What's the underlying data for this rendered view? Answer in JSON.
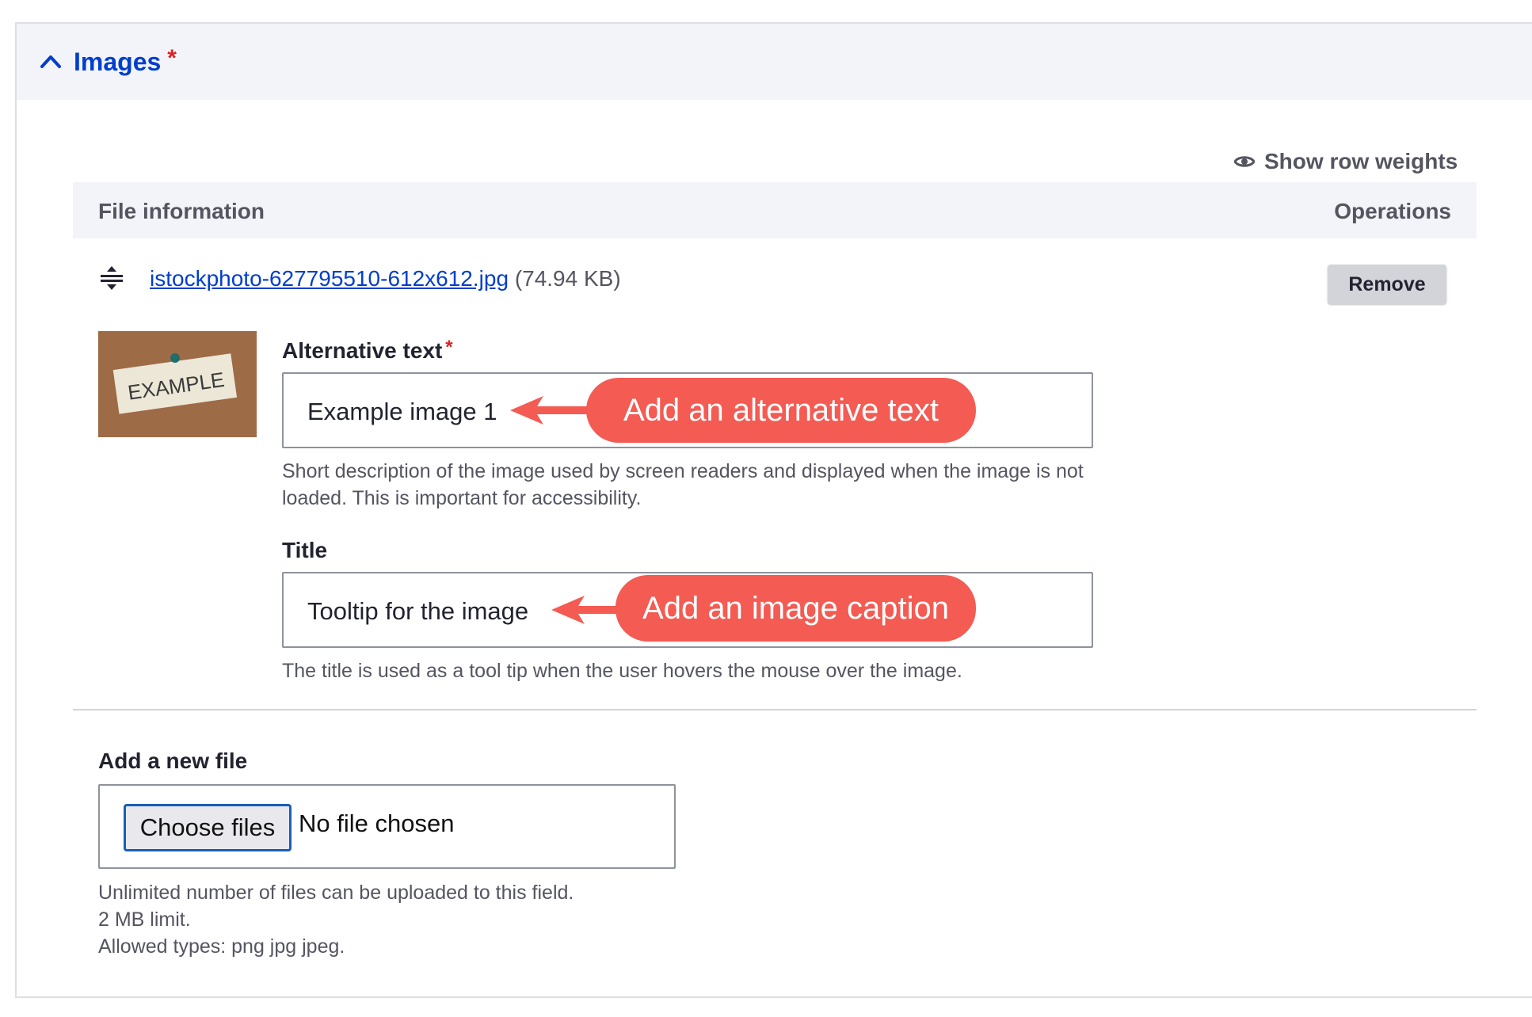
{
  "section": {
    "title": "Images",
    "required_mark": "*"
  },
  "toolbar": {
    "row_weights_label": "Show row weights"
  },
  "table": {
    "col_file": "File information",
    "col_operations": "Operations"
  },
  "file": {
    "name": "istockphoto-627795510-612x612.jpg",
    "size": "(74.94 KB)",
    "remove_label": "Remove",
    "thumbnail_text": "EXAMPLE"
  },
  "alt_field": {
    "label": "Alternative text",
    "required_mark": "*",
    "value": "Example image 1",
    "callout": "Add an alternative text",
    "description": "Short description of the image used by screen readers and displayed when the image is not loaded. This is important for accessibility."
  },
  "title_field": {
    "label": "Title",
    "value": "Tooltip for the image",
    "callout": "Add an image caption",
    "description": "The title is used as a tool tip when the user hovers the mouse over the image."
  },
  "upload": {
    "label": "Add a new file",
    "button_label": "Choose files",
    "status": "No file chosen",
    "help_line_1": "Unlimited number of files can be uploaded to this field.",
    "help_line_2": "2 MB limit.",
    "help_line_3": "Allowed types: png jpg jpeg."
  },
  "colors": {
    "accent": "#003ecc",
    "required": "#dc2323",
    "callout": "#f35b53",
    "header_bg": "#f3f4f9"
  },
  "icons": [
    "chevron-up-icon",
    "eye-icon",
    "drag-handle-icon"
  ]
}
